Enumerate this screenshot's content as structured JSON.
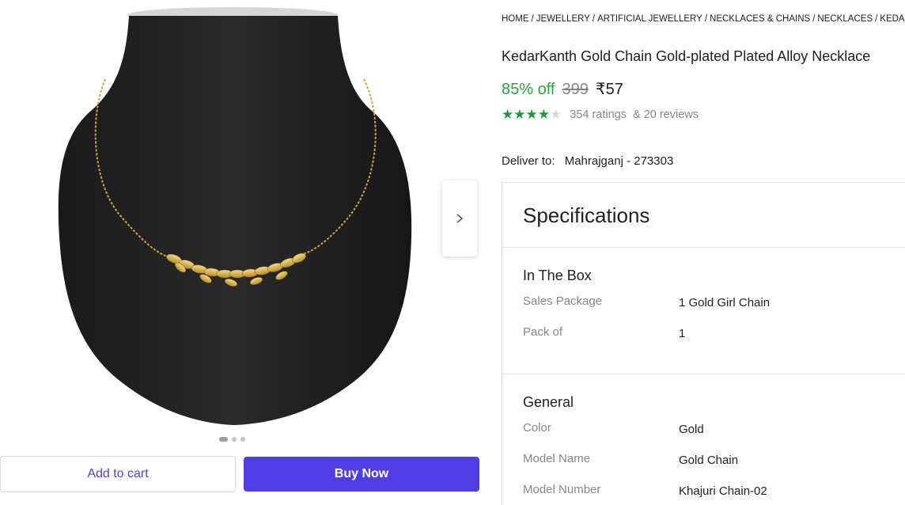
{
  "breadcrumb": [
    "HOME",
    "JEWELLERY",
    "ARTIFICIAL JEWELLERY",
    "NECKLACES & CHAINS",
    "NECKLACES",
    "KEDARKA"
  ],
  "product": {
    "title": "KedarKanth Gold Chain Gold-plated Plated Alloy Necklace",
    "discount": "85% off",
    "mrp": "399",
    "price": "₹57",
    "rating_stars": 4,
    "ratings": "354 ratings",
    "reviews": "& 20 reviews"
  },
  "delivery": {
    "label": "Deliver to:",
    "location": "Mahrajganj - 273303"
  },
  "gallery": {
    "slides": 3,
    "active_slide": 0,
    "next_icon": "chevron-right-icon"
  },
  "actions": {
    "add_to_cart": "Add to cart",
    "buy_now": "Buy Now"
  },
  "specifications": {
    "heading": "Specifications",
    "sections": [
      {
        "title": "In The Box",
        "rows": [
          {
            "label": "Sales Package",
            "value": "1 Gold Girl Chain"
          },
          {
            "label": "Pack of",
            "value": "1"
          }
        ]
      },
      {
        "title": "General",
        "rows": [
          {
            "label": "Color",
            "value": "Gold"
          },
          {
            "label": "Model Name",
            "value": "Gold Chain"
          },
          {
            "label": "Model Number",
            "value": "Khajuri Chain-02"
          }
        ]
      }
    ]
  },
  "colors": {
    "accent": "#4f3ee6",
    "discount_green": "#26a541",
    "star_green": "#1a9a3a"
  }
}
